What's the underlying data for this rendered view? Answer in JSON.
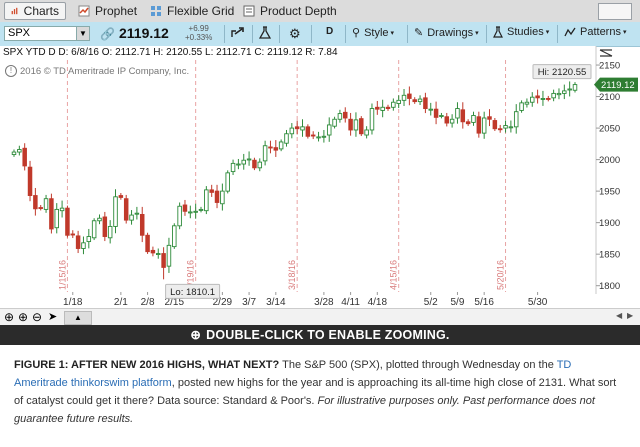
{
  "tabs": [
    {
      "label": "Charts",
      "active": true,
      "icon": "bar-chart-icon"
    },
    {
      "label": "Prophet",
      "active": false,
      "icon": "prophet-icon"
    },
    {
      "label": "Flexible Grid",
      "active": false,
      "icon": "grid-icon"
    },
    {
      "label": "Product Depth",
      "active": false,
      "icon": "depth-icon"
    }
  ],
  "toolbar": {
    "symbol": "SPX",
    "price": "2119.12",
    "change": "+6.99",
    "change_pct": "+0.33%",
    "period": "D",
    "style_label": "Style",
    "drawings_label": "Drawings",
    "studies_label": "Studies",
    "patterns_label": "Patterns"
  },
  "info": {
    "header": "SPX YTD D",
    "date": "D: 6/8/16",
    "open": "O: 2112.71",
    "high": "H: 2120.55",
    "low": "L: 2112.71",
    "close": "C: 2119.12",
    "range": "R: 7.84",
    "copyright": "2016 © TD Ameritrade IP Company, Inc."
  },
  "zoom_hint": "DOUBLE-CLICK TO ENABLE ZOOMING.",
  "caption": {
    "title": "FIGURE 1: AFTER NEW 2016 HIGHS, WHAT NEXT?",
    "part1": " The S&P 500 (SPX), plotted through Wednesday on the ",
    "link": "TD Ameritrade thinkorswim platform",
    "part2": ", posted new highs for the year and is approaching its all-time high close of 2131. What sort of catalyst could get it there? Data source: Standard & Poor's. ",
    "disclaimer": "For illustrative purposes only. Past performance does not guarantee future results."
  },
  "colors": {
    "up": "#2e8b3a",
    "down": "#c0392b",
    "event_line": "#e8a3a3",
    "event_label": "#d97b7b",
    "price_tag": "#2e7d32",
    "toolbar_bg": "#bfe3f1",
    "zoom_bar": "#2b2b2b"
  },
  "chart_data": {
    "type": "candlestick",
    "ylim": [
      1790,
      2158
    ],
    "yticks": [
      1800,
      1850,
      1900,
      1950,
      2000,
      2050,
      2100,
      2150
    ],
    "xtick_labels": [
      {
        "label": "1/18",
        "day": 11
      },
      {
        "label": "2/1",
        "day": 20
      },
      {
        "label": "2/8",
        "day": 25
      },
      {
        "label": "2/15",
        "day": 30
      },
      {
        "label": "2/29",
        "day": 39
      },
      {
        "label": "3/7",
        "day": 44
      },
      {
        "label": "3/14",
        "day": 49
      },
      {
        "label": "3/28",
        "day": 58
      },
      {
        "label": "4/11",
        "day": 63
      },
      {
        "label": "4/18",
        "day": 68
      },
      {
        "label": "5/2",
        "day": 78
      },
      {
        "label": "5/9",
        "day": 83
      },
      {
        "label": "5/16",
        "day": 88
      },
      {
        "label": "5/30",
        "day": 98
      }
    ],
    "events": [
      {
        "label": "1/15/16",
        "day": 10
      },
      {
        "label": "2/19/16",
        "day": 34
      },
      {
        "label": "3/18/16",
        "day": 53
      },
      {
        "label": "4/15/16",
        "day": 72
      },
      {
        "label": "5/20/16",
        "day": 92
      }
    ],
    "annotations": {
      "high_label": "Hi: 2120.55",
      "low_label": "Lo: 1810.1",
      "last_price": "2119.12",
      "low_value": 1810.1,
      "high_value": 2120.55
    },
    "closes": [
      2012,
      2016,
      1990,
      1943,
      1922,
      1923,
      1938,
      1890,
      1921,
      1923,
      1880,
      1881,
      1859,
      1868,
      1878,
      1903,
      1907,
      1878,
      1894,
      1941,
      1940,
      1904,
      1912,
      1915,
      1880,
      1854,
      1852,
      1851,
      1829,
      1864,
      1895,
      1926,
      1918,
      1917,
      1918,
      1921,
      1952,
      1948,
      1932,
      1950,
      1979,
      1994,
      1993,
      1999,
      2001,
      1987,
      1996,
      2022,
      2019,
      2015,
      2028,
      2041,
      2050,
      2049,
      2052,
      2037,
      2038,
      2036,
      2037,
      2055,
      2064,
      2073,
      2066,
      2047,
      2063,
      2041,
      2047,
      2081,
      2080,
      2083,
      2081,
      2091,
      2094,
      2102,
      2097,
      2092,
      2096,
      2081,
      2080,
      2067,
      2070,
      2058,
      2064,
      2081,
      2060,
      2057,
      2070,
      2042,
      2066,
      2064,
      2049,
      2048,
      2054,
      2052,
      2076,
      2090,
      2091,
      2099,
      2098,
      2097,
      2096,
      2105,
      2105,
      2109,
      2112,
      2119
    ]
  }
}
